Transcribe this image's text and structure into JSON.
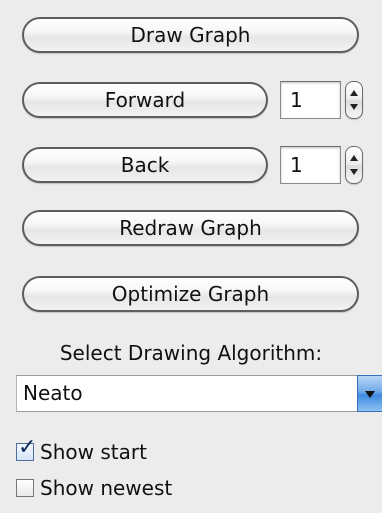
{
  "buttons": {
    "draw_graph": "Draw Graph",
    "forward": "Forward",
    "back": "Back",
    "redraw_graph": "Redraw Graph",
    "optimize_graph": "Optimize Graph"
  },
  "steps": {
    "forward_value": "1",
    "back_value": "1"
  },
  "algorithm": {
    "label": "Select Drawing Algorithm:",
    "selected": "Neato"
  },
  "options": {
    "show_start": {
      "label": "Show start",
      "checked": true
    },
    "show_newest": {
      "label": "Show newest",
      "checked": false
    }
  },
  "icons": {
    "stepper": "up-down-arrows-icon",
    "dropdown": "chevron-down-icon",
    "checkbox_checked": "checkmark-icon"
  },
  "colors": {
    "background": "#ececec",
    "select_button": "#3f8ae0",
    "checkmark": "#0f2a58"
  }
}
